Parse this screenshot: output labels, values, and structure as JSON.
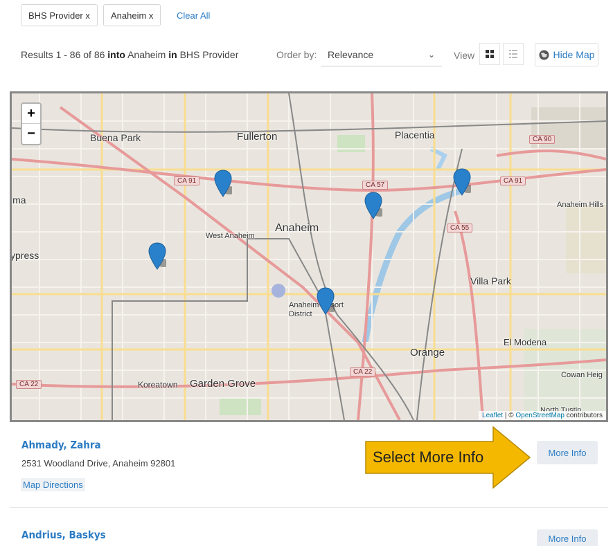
{
  "filters": {
    "chips": [
      "BHS Provider x",
      "Anaheim x"
    ],
    "clear_all": "Clear All"
  },
  "toolbar": {
    "results_prefix": "Results 1 - 86 of 86",
    "into_word": "into",
    "location": "Anaheim",
    "in_word": "in",
    "category": "BHS Provider",
    "order_label": "Order by:",
    "order_value": "Relevance",
    "view_label": "View",
    "hide_map_label": "Hide Map"
  },
  "map": {
    "zoom_in": "+",
    "zoom_out": "−",
    "place_labels": [
      "Buena Park",
      "Fullerton",
      "Placentia",
      "Anaheim",
      "West Anaheim",
      "ypress",
      "lma",
      "Villa Park",
      "El Modena",
      "Orange",
      "Garden Grove",
      "Koreatown",
      "Anaheim Hills",
      "Cowan Heig",
      "North Tustin",
      "Anaheim Resort District"
    ],
    "highway_shields": [
      "CA 91",
      "CA 57",
      "CA 91",
      "CA 55",
      "CA 90",
      "CA 22",
      "CA 22"
    ],
    "attribution_leaflet": "Leaflet",
    "attribution_sep": " | © ",
    "attribution_osm": "OpenStreetMap",
    "attribution_tail": " contributors"
  },
  "results": [
    {
      "name": "Ahmady, Zahra",
      "address": "2531 Woodland Drive, Anaheim 92801",
      "directions": "Map Directions",
      "more_info": "More Info"
    },
    {
      "name": "Andrius, Baskys",
      "more_info": "More Info"
    }
  ],
  "callout": {
    "text": "Select More Info",
    "color": "#f5b800"
  },
  "colors": {
    "link": "#2c7cc4",
    "marker": "#2a81cb"
  }
}
